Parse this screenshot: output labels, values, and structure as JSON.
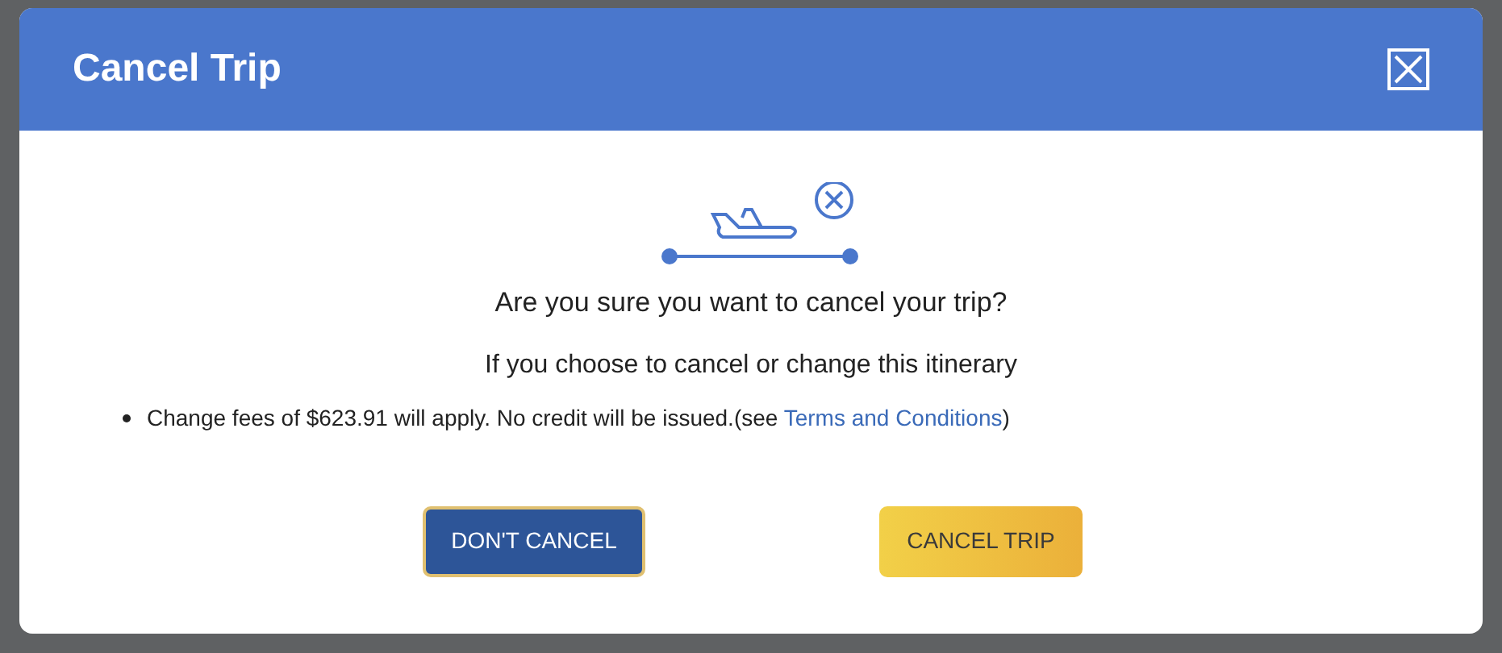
{
  "dialog": {
    "title": "Cancel Trip",
    "question": "Are you sure you want to cancel your trip?",
    "subtitle": "If you choose to cancel or change this itinerary",
    "bullets": [
      {
        "before": "Change fees of $623.91 will apply. No credit will be issued.(see ",
        "link": "Terms and Conditions",
        "after": ")"
      }
    ],
    "buttons": [
      {
        "label": "DON'T CANCEL",
        "kind": "secondary"
      },
      {
        "label": "CANCEL TRIP",
        "kind": "primary"
      }
    ]
  }
}
